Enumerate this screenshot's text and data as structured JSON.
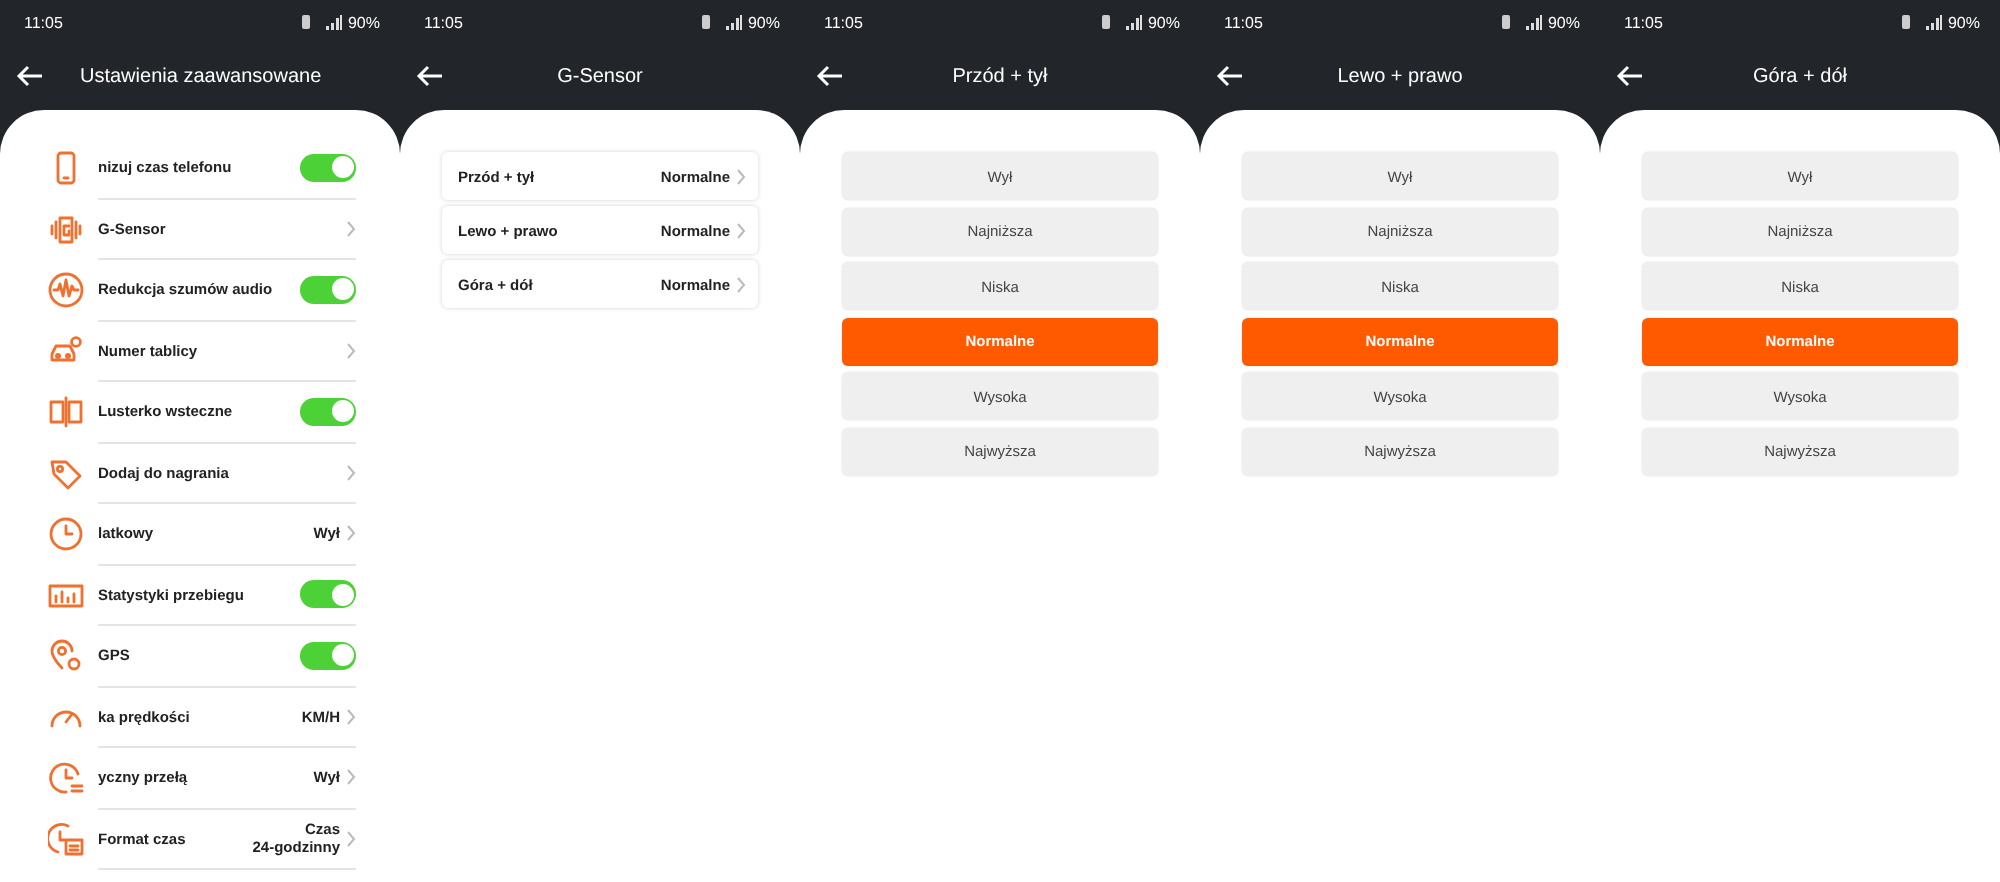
{
  "screens": [
    {
      "kind": "settings",
      "status": {
        "time": "11:05",
        "battery": "90%"
      },
      "title": "Ustawienia zaawansowane",
      "items": [
        {
          "kind": "toggle",
          "label": "nizuj czas telefonu",
          "on": true
        },
        {
          "kind": "link",
          "label": "G-Sensor"
        },
        {
          "kind": "toggle",
          "label": "Redukcja szumów audio",
          "on": true
        },
        {
          "kind": "link",
          "label": "Numer tablicy"
        },
        {
          "kind": "toggle",
          "label": "Lusterko wsteczne",
          "on": true
        },
        {
          "kind": "link",
          "label": "Dodaj do nagrania"
        },
        {
          "kind": "link",
          "label": "latkowy",
          "value": "Wył"
        },
        {
          "kind": "toggle",
          "label": "Statystyki przebiegu",
          "on": true
        },
        {
          "kind": "toggle",
          "label": "GPS",
          "on": true
        },
        {
          "kind": "link",
          "label": "ka prędkości",
          "value": "KM/H"
        },
        {
          "kind": "link",
          "label": "yczny przełą",
          "value": "Wył"
        },
        {
          "kind": "link",
          "label": "Format czas",
          "value": "Czas 24-godzinny"
        }
      ]
    },
    {
      "kind": "submenu",
      "status": {
        "time": "11:05",
        "battery": "90%"
      },
      "title": "G-Sensor",
      "items": [
        {
          "label": "Przód + tył",
          "value": "Normalne"
        },
        {
          "label": "Lewo + prawo",
          "value": "Normalne"
        },
        {
          "label": "Góra + dół",
          "value": "Normalne"
        }
      ]
    },
    {
      "kind": "options",
      "status": {
        "time": "11:05",
        "battery": "90%"
      },
      "title": "Przód + tył",
      "options": [
        {
          "label": "Wył",
          "selected": false
        },
        {
          "label": "Najniższa",
          "selected": false
        },
        {
          "label": "Niska",
          "selected": false
        },
        {
          "label": "Normalne",
          "selected": true
        },
        {
          "label": "Wysoka",
          "selected": false
        },
        {
          "label": "Najwyższa",
          "selected": false
        }
      ]
    },
    {
      "kind": "options",
      "status": {
        "time": "11:05",
        "battery": "90%"
      },
      "title": "Lewo + prawo",
      "options": [
        {
          "label": "Wył",
          "selected": false
        },
        {
          "label": "Najniższa",
          "selected": false
        },
        {
          "label": "Niska",
          "selected": false
        },
        {
          "label": "Normalne",
          "selected": true
        },
        {
          "label": "Wysoka",
          "selected": false
        },
        {
          "label": "Najwyższa",
          "selected": false
        }
      ]
    },
    {
      "kind": "options",
      "status": {
        "time": "11:05",
        "battery": "90%"
      },
      "title": "Góra + dół",
      "options": [
        {
          "label": "Wył",
          "selected": false
        },
        {
          "label": "Najniższa",
          "selected": false
        },
        {
          "label": "Niska",
          "selected": false
        },
        {
          "label": "Normalne",
          "selected": true
        },
        {
          "label": "Wysoka",
          "selected": false
        },
        {
          "label": "Najwyższa",
          "selected": false
        }
      ]
    }
  ]
}
